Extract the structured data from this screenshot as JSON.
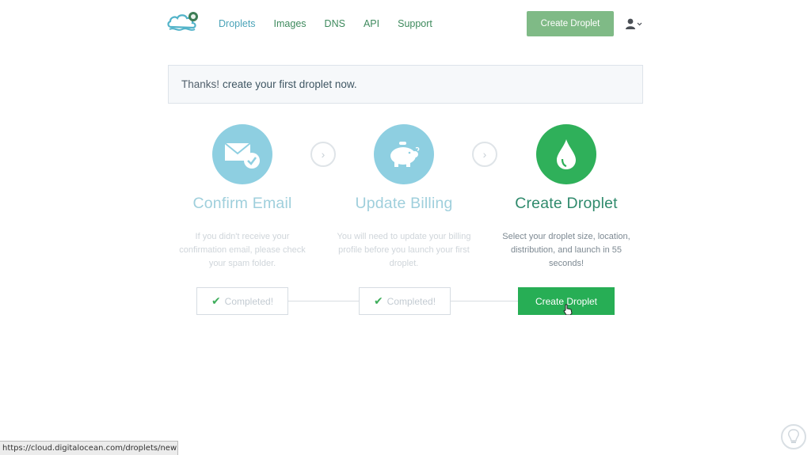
{
  "header": {
    "nav": [
      "Droplets",
      "Images",
      "DNS",
      "API",
      "Support"
    ],
    "create_button": "Create Droplet",
    "user_icon": "user-icon"
  },
  "notice": {
    "prefix": "Thanks!",
    "link_text": "create your first droplet now."
  },
  "steps": [
    {
      "title": "Confirm Email",
      "description": "If you didn't receive your confirmation email, please check your spam folder.",
      "button": "Completed!",
      "icon": "envelope-check-icon",
      "state": "completed"
    },
    {
      "title": "Update Billing",
      "description": "You will need to update your billing profile before you launch your first droplet.",
      "button": "Completed!",
      "icon": "piggy-bank-icon",
      "state": "completed"
    },
    {
      "title": "Create Droplet",
      "description": "Select your droplet size, location, distribution, and launch in 55 seconds!",
      "button": "Create Droplet",
      "icon": "droplet-icon",
      "state": "active"
    }
  ],
  "statusbar": {
    "url": "https://cloud.digitalocean.com/droplets/new"
  },
  "colors": {
    "brand_green": "#27ae55",
    "accent_blue": "#8ecfe1",
    "top_button": "#7fba86"
  }
}
